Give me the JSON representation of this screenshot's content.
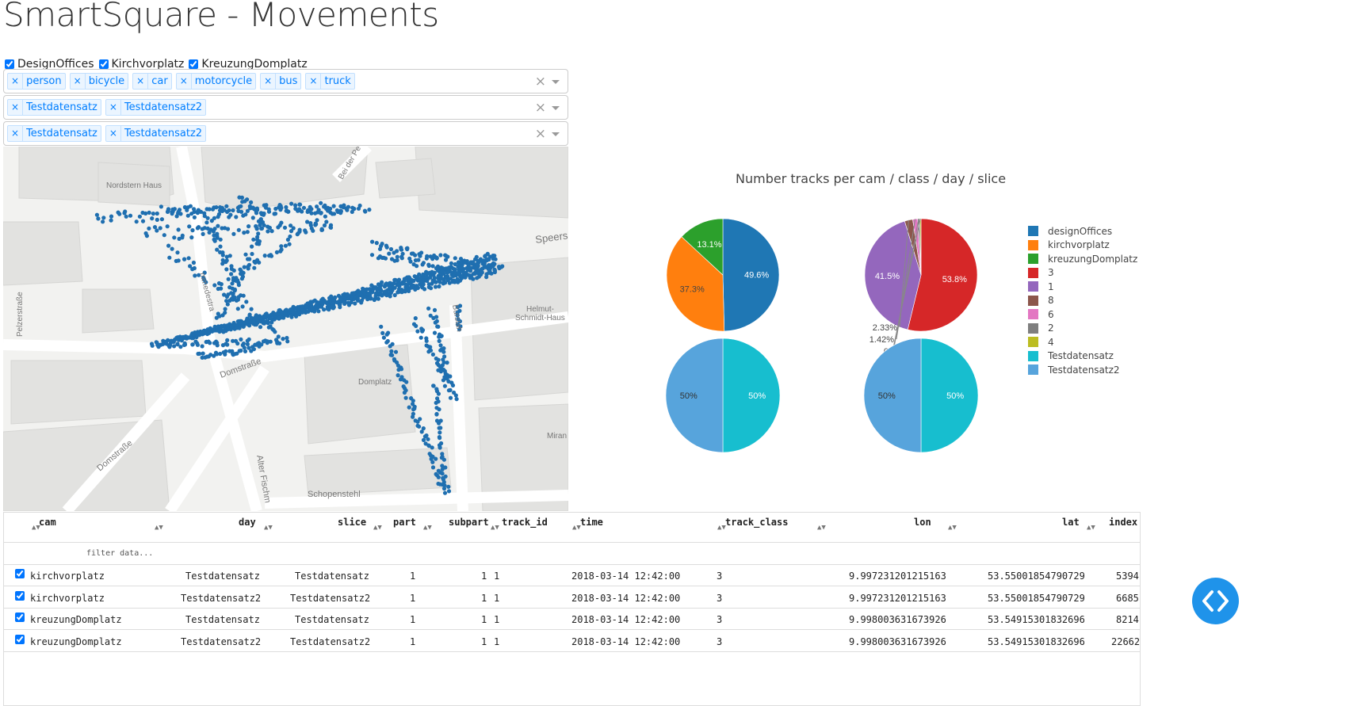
{
  "page": {
    "title": "SmartSquare - Movements"
  },
  "checkboxes": [
    {
      "label": "DesignOffices",
      "checked": true
    },
    {
      "label": "Kirchvorplatz",
      "checked": true
    },
    {
      "label": "KreuzungDomplatz",
      "checked": true
    }
  ],
  "class_filter": {
    "tags": [
      "person",
      "bicycle",
      "car",
      "motorcycle",
      "bus",
      "truck"
    ],
    "clear": "×"
  },
  "day_filter": {
    "tags": [
      "Testdatensatz",
      "Testdatensatz2"
    ],
    "clear": "×"
  },
  "slice_filter": {
    "tags": [
      "Testdatensatz",
      "Testdatensatz2"
    ],
    "clear": "×"
  },
  "map": {
    "labels": [
      "Nordstern Haus",
      "Bei der Pe",
      "Speers",
      "Pelzerstraße",
      "mmedestra",
      "Helmut-",
      "Schmidt-Haus",
      "Domstraße",
      "Domplatz",
      "Burstah",
      "Domstraße",
      "Alter Fischm",
      "Schopenstehl",
      "Miran"
    ],
    "point_color": "#1f6fb0"
  },
  "chart": {
    "title": "Number tracks per cam / class / day / slice",
    "colors": {
      "designOffices": "#1f77b4",
      "kirchvorplatz": "#ff7f0e",
      "kreuzungDomplatz": "#2ca02c",
      "3": "#d62728",
      "1": "#9467bd",
      "8": "#8c564b",
      "6": "#e377c2",
      "2": "#7f7f7f",
      "4": "#bcbd22",
      "Testdatensatz": "#17becf",
      "Testdatensatz2": "#57a4dc"
    }
  },
  "chart_data": [
    {
      "type": "pie",
      "title": "Number tracks per cam / class / day / slice",
      "labels": [
        "designOffices",
        "kirchvorplatz",
        "kreuzungDomplatz"
      ],
      "values": [
        49.6,
        37.3,
        13.1
      ],
      "text": [
        "49.6%",
        "37.3%",
        "13.1%"
      ]
    },
    {
      "type": "pie",
      "labels": [
        "3",
        "1",
        "8",
        "6",
        "2",
        "4"
      ],
      "values": [
        53.8,
        41.5,
        2.33,
        1.42,
        0.6,
        0.35
      ],
      "text": [
        "53.8%",
        "41.5%",
        "2.33%",
        "1.42%",
        "0.",
        "0."
      ]
    },
    {
      "type": "pie",
      "labels": [
        "Testdatensatz",
        "Testdatensatz2"
      ],
      "values": [
        50,
        50
      ],
      "text": [
        "50%",
        "50%"
      ]
    },
    {
      "type": "pie",
      "labels": [
        "Testdatensatz",
        "Testdatensatz2"
      ],
      "values": [
        50,
        50
      ],
      "text": [
        "50%",
        "50%"
      ]
    }
  ],
  "legend": [
    "designOffices",
    "kirchvorplatz",
    "kreuzungDomplatz",
    "3",
    "1",
    "8",
    "6",
    "2",
    "4",
    "Testdatensatz",
    "Testdatensatz2"
  ],
  "table": {
    "columns": [
      "cam",
      "day",
      "slice",
      "part",
      "subpart",
      "track_id",
      "time",
      "track_class",
      "lon",
      "lat",
      "index"
    ],
    "filter_placeholder": "filter data...",
    "rows": [
      {
        "cam": "kirchvorplatz",
        "day": "Testdatensatz",
        "slice": "Testdatensatz",
        "part": "1",
        "subpart": "1",
        "track_id": "1",
        "time": "2018-03-14 12:42:00",
        "track_class": "3",
        "lon": "9.997231201215163",
        "lat": "53.55001854790729",
        "index": "5394"
      },
      {
        "cam": "kirchvorplatz",
        "day": "Testdatensatz2",
        "slice": "Testdatensatz2",
        "part": "1",
        "subpart": "1",
        "track_id": "1",
        "time": "2018-03-14 12:42:00",
        "track_class": "3",
        "lon": "9.997231201215163",
        "lat": "53.55001854790729",
        "index": "6685"
      },
      {
        "cam": "kreuzungDomplatz",
        "day": "Testdatensatz",
        "slice": "Testdatensatz",
        "part": "1",
        "subpart": "1",
        "track_id": "1",
        "time": "2018-03-14 12:42:00",
        "track_class": "3",
        "lon": "9.998003631673926",
        "lat": "53.54915301832696",
        "index": "8214"
      },
      {
        "cam": "kreuzungDomplatz",
        "day": "Testdatensatz2",
        "slice": "Testdatensatz2",
        "part": "1",
        "subpart": "1",
        "track_id": "1",
        "time": "2018-03-14 12:42:00",
        "track_class": "3",
        "lon": "9.998003631673926",
        "lat": "53.54915301832696",
        "index": "22662"
      }
    ]
  }
}
